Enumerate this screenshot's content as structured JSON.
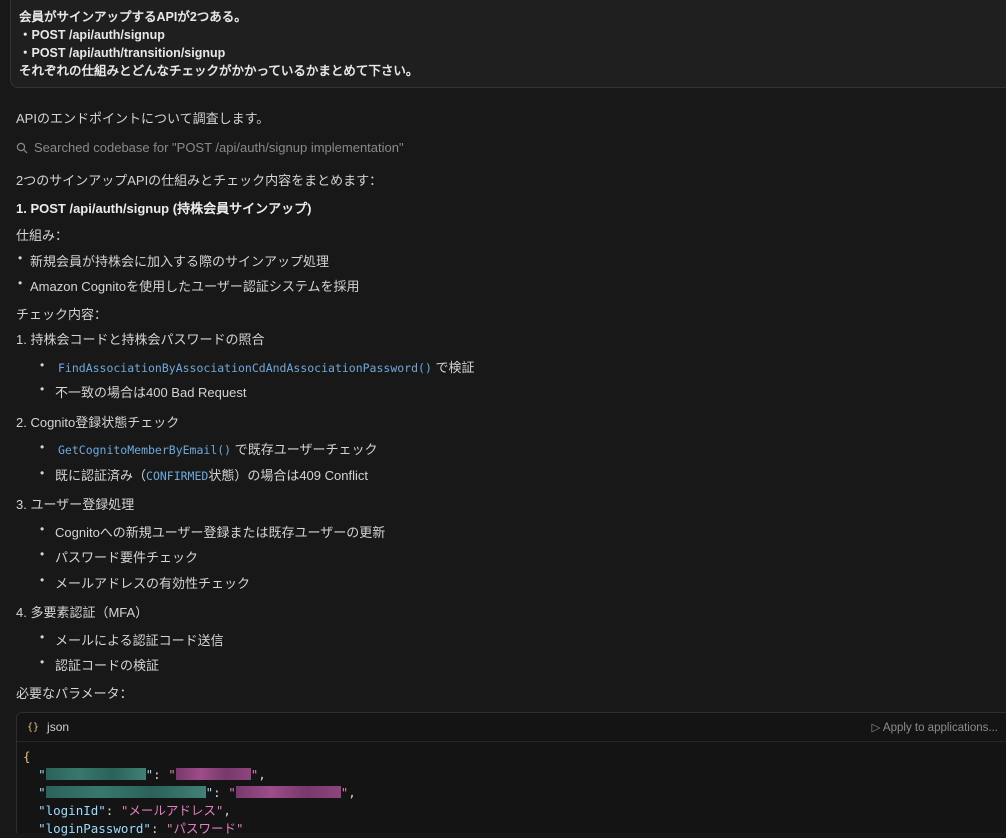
{
  "user_message": {
    "lines": [
      "会員がサインアップするAPIが2つある。",
      "・POST /api/auth/signup",
      "・POST /api/auth/transition/signup",
      "それぞれの仕組みとどんなチェックがかかっているかまとめて下さい。"
    ]
  },
  "assistant": {
    "intro": "APIのエンドポイントについて調査します。",
    "searched": "Searched codebase for \"POST /api/auth/signup implementation\"",
    "summary_lead": "2つのサインアップAPIの仕組みとチェック内容をまとめます：",
    "section1_title": "1. POST /api/auth/signup (持株会員サインアップ)",
    "mechanism_label": "仕組み：",
    "mechanism_items": [
      "新規会員が持株会に加入する際のサインアップ処理",
      "Amazon Cognitoを使用したユーザー認証システムを採用"
    ],
    "checks_label": "チェック内容：",
    "check1_title": "1. 持株会コードと持株会パスワードの照合",
    "check1_item1_code": "FindAssociationByAssociationCdAndAssociationPassword()",
    "check1_item1_text": "で検証",
    "check1_item2": "不一致の場合は400 Bad Request",
    "check2_title": "2. Cognito登録状態チェック",
    "check2_item1_code": "GetCognitoMemberByEmail()",
    "check2_item1_text": "で既存ユーザーチェック",
    "check2_item2_pre": "既に認証済み（",
    "check2_item2_code": "CONFIRMED",
    "check2_item2_post": "状態）の場合は409 Conflict",
    "check3_title": "3. ユーザー登録処理",
    "check3_items": [
      "Cognitoへの新規ユーザー登録または既存ユーザーの更新",
      "パスワード要件チェック",
      "メールアドレスの有効性チェック"
    ],
    "check4_title": "4. 多要素認証（MFA）",
    "check4_items": [
      "メールによる認証コード送信",
      "認証コードの検証"
    ],
    "params_label": "必要なパラメータ：",
    "codeblock": {
      "lang": "json",
      "apply_label": "Apply to applications...",
      "open_brace": "{",
      "line3_key": "\"loginId\"",
      "line3_val": "\"メールアドレス\"",
      "line4_key": "\"loginPassword\"",
      "line4_val": "\"パスワード\""
    }
  },
  "colors": {
    "background": "#181818",
    "code_inline": "#6fa8dc",
    "json_key": "#9cdcfe",
    "json_string": "#e57ec3",
    "brace": "#e5c07b"
  }
}
